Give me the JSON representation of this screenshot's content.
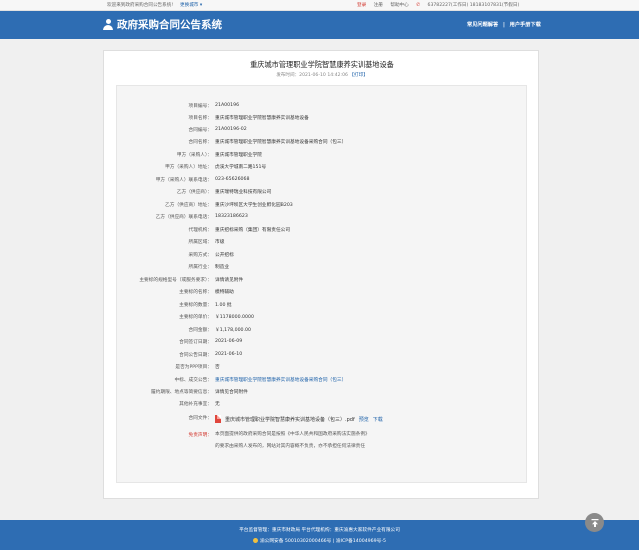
{
  "topbar": {
    "welcome": "欢迎来到政府采购合同公告系统!",
    "switch_label": "更换城市 ▾",
    "login": "登录",
    "register": "注册",
    "help": "帮助中心",
    "phone_label": "63782227(工作日) 18183107831(节假日)"
  },
  "header": {
    "site_title": "政府采购合同公告系统",
    "nav_help": "常见问题解答",
    "nav_separator": "|",
    "nav_download": "用户手册下载"
  },
  "document": {
    "title": "重庆城市管理职业学院智慧康养实训基地设备",
    "meta_prefix": "发布时间：2021-06-10 14:42:06",
    "print_label": "【打印】"
  },
  "fields": [
    {
      "label": "项目编号：",
      "value": "21A00196"
    },
    {
      "label": "项目名称：",
      "value": "重庆城市管理职业学院智慧康养实训基地设备"
    },
    {
      "label": "合同编号：",
      "value": "21A00196-02"
    },
    {
      "label": "合同名称：",
      "value": "重庆城市管理职业学院智慧康养实训基地设备采购合同（包三）"
    },
    {
      "label": "甲方（采购人）：",
      "value": "重庆城市管理职业学院"
    },
    {
      "label": "甲方（采购人）地址：",
      "value": "虎溪大学城南二路151号"
    },
    {
      "label": "甲方（采购人）联系电话：",
      "value": "023-65626068"
    },
    {
      "label": "乙方（供应商）：",
      "value": "重庆瑞特瑞业科技有限公司"
    },
    {
      "label": "乙方（供应商）地址：",
      "value": "重庆沙坪坝区大学生创业孵化园B203"
    },
    {
      "label": "乙方（供应商）联系电话：",
      "value": "18323186623"
    },
    {
      "label": "代理机构：",
      "value": "重庆招标采购（集团）有限责任公司"
    },
    {
      "label": "所属区域：",
      "value": "市级"
    },
    {
      "label": "采购方式：",
      "value": "公开招标"
    },
    {
      "label": "所属行业：",
      "value": "制造业"
    },
    {
      "label": "主要标的规格型号（或服务要求）：",
      "value": "详情请见附件"
    },
    {
      "label": "主要标的名称：",
      "value": "模特辅助"
    },
    {
      "label": "主要标的数量：",
      "value": "1.00 批"
    },
    {
      "label": "主要标的单价：",
      "value": "￥1178000.0000"
    },
    {
      "label": "合同金额：",
      "value": "￥1,178,000.00"
    },
    {
      "label": "合同签订日期：",
      "value": "2021-06-09"
    },
    {
      "label": "合同公告日期：",
      "value": "2021-06-10"
    },
    {
      "label": "是否为PPP项目：",
      "value": "否"
    },
    {
      "label": "中标、成交公告：",
      "value": "重庆城市管理职业学院智慧康养实训基地设备采购合同（包三）",
      "link": true
    },
    {
      "label": "履约期限、地点等简要信息：",
      "value": "详情见合同附件"
    },
    {
      "label": "其他补充事宜：",
      "value": "无"
    }
  ],
  "attachment": {
    "label": "合同文件：",
    "filename": "重庆城市管理职业学院智慧康养实训基地设备（包三）.pdf",
    "preview": "预览",
    "download": "下载"
  },
  "disclaimer": {
    "label": "免责声明：",
    "line1": "本页面提供的政府采购合同是按照《中华人民共和国政府采购法实施条例》",
    "line2": "的要求由采购人发布的，网站对其内容概不负责，亦不承担任何法律责任"
  },
  "footer": {
    "line1": "平台监督管理：重庆市财政局     平台代理机构：重庆渝惠大家软件产业有限公司",
    "line2": "渝公网安备 50010302000466号  |  渝ICP备14004969号-5"
  },
  "colors": {
    "brand": "#2e6db3",
    "link": "#1a5fa8",
    "danger": "#d2352c"
  }
}
